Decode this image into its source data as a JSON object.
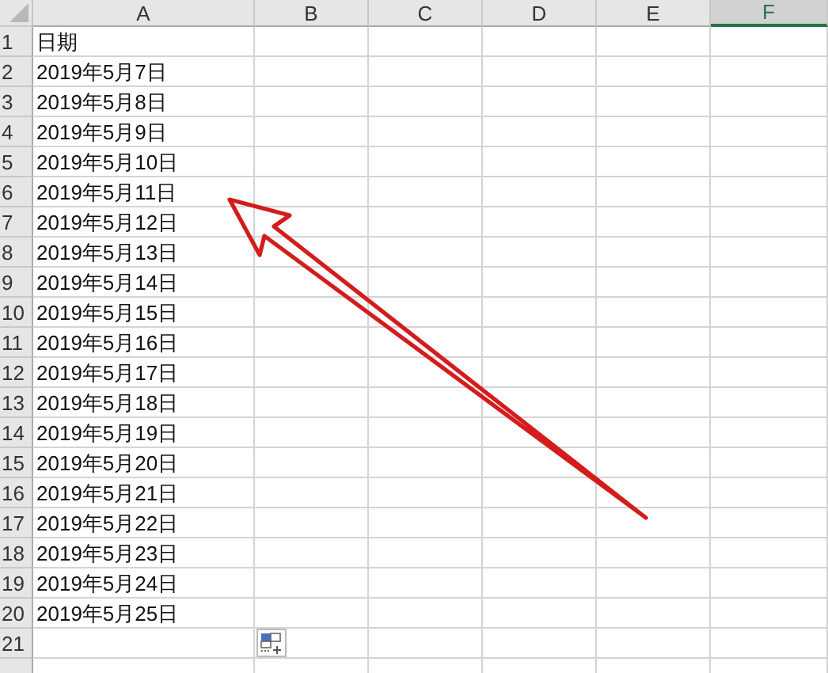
{
  "columns": [
    {
      "label": "A",
      "selected": false
    },
    {
      "label": "B",
      "selected": false
    },
    {
      "label": "C",
      "selected": false
    },
    {
      "label": "D",
      "selected": false
    },
    {
      "label": "E",
      "selected": false
    },
    {
      "label": "F",
      "selected": true
    }
  ],
  "rows": [
    {
      "number": "1",
      "cell": "日期"
    },
    {
      "number": "2",
      "cell": "2019年5月7日"
    },
    {
      "number": "3",
      "cell": "2019年5月8日"
    },
    {
      "number": "4",
      "cell": "2019年5月9日"
    },
    {
      "number": "5",
      "cell": "2019年5月10日"
    },
    {
      "number": "6",
      "cell": "2019年5月11日"
    },
    {
      "number": "7",
      "cell": "2019年5月12日"
    },
    {
      "number": "8",
      "cell": "2019年5月13日"
    },
    {
      "number": "9",
      "cell": "2019年5月14日"
    },
    {
      "number": "10",
      "cell": "2019年5月15日"
    },
    {
      "number": "11",
      "cell": "2019年5月16日"
    },
    {
      "number": "12",
      "cell": "2019年5月17日"
    },
    {
      "number": "13",
      "cell": "2019年5月18日"
    },
    {
      "number": "14",
      "cell": "2019年5月19日"
    },
    {
      "number": "15",
      "cell": "2019年5月20日"
    },
    {
      "number": "16",
      "cell": "2019年5月21日"
    },
    {
      "number": "17",
      "cell": "2019年5月22日"
    },
    {
      "number": "18",
      "cell": "2019年5月23日"
    },
    {
      "number": "19",
      "cell": "2019年5月24日"
    },
    {
      "number": "20",
      "cell": "2019年5月25日"
    },
    {
      "number": "21"
    }
  ]
}
